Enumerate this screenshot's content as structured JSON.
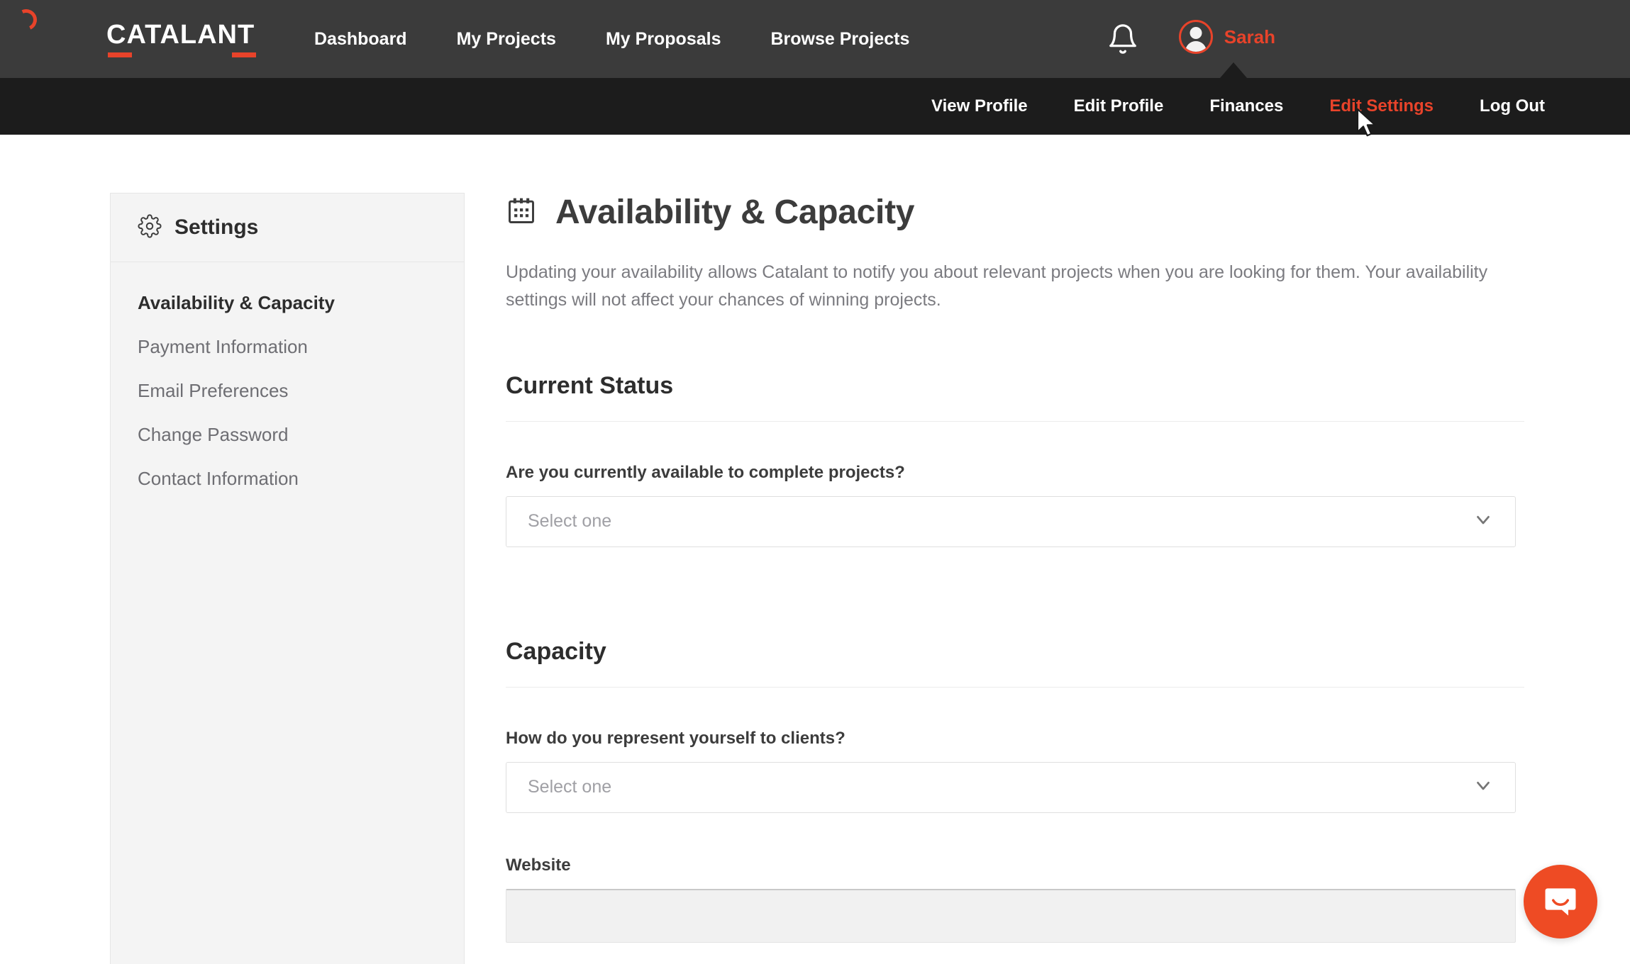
{
  "topnav": {
    "logo": "CATALANT",
    "spinner_icon": "loading-spinner-icon",
    "bell_icon": "notification-bell-icon",
    "avatar_icon": "user-avatar-icon",
    "username": "Sarah",
    "accent_color": "#e8432a",
    "background_color": "#3b3b3b",
    "links": [
      {
        "label": "Dashboard"
      },
      {
        "label": "My Projects"
      },
      {
        "label": "My Proposals"
      },
      {
        "label": "Browse Projects"
      }
    ]
  },
  "subnav": {
    "background_color": "#1c1c1c",
    "active_color": "#e8432a",
    "links": [
      {
        "label": "View Profile",
        "active": false
      },
      {
        "label": "Edit Profile",
        "active": false
      },
      {
        "label": "Finances",
        "active": false
      },
      {
        "label": "Edit Settings",
        "active": true
      },
      {
        "label": "Log Out",
        "active": false
      }
    ]
  },
  "sidebar": {
    "title": "Settings",
    "gear_icon": "gear-icon",
    "items": [
      {
        "label": "Availability & Capacity",
        "active": true
      },
      {
        "label": "Payment Information",
        "active": false
      },
      {
        "label": "Email Preferences",
        "active": false
      },
      {
        "label": "Change Password",
        "active": false
      },
      {
        "label": "Contact Information",
        "active": false
      }
    ]
  },
  "main": {
    "calendar_icon": "calendar-icon",
    "page_title": "Availability & Capacity",
    "description": "Updating your availability allows Catalant to notify you about relevant projects when you are looking for them. Your availability settings will not affect your chances of winning projects.",
    "sections": [
      {
        "title": "Current Status",
        "field_label": "Are you currently available to complete projects?",
        "select_placeholder": "Select one",
        "select_value": "",
        "chevron_icon": "chevron-down-icon"
      },
      {
        "title": "Capacity",
        "field_label": "How do you represent yourself to clients?",
        "select_placeholder": "Select one",
        "select_value": "",
        "chevron_icon": "chevron-down-icon"
      }
    ],
    "website_field": {
      "label": "Website",
      "value": "",
      "placeholder": ""
    }
  },
  "chat_widget": {
    "icon": "chat-bubble-icon",
    "color": "#ee4b24"
  },
  "cursor": {
    "icon": "mouse-cursor-icon"
  }
}
